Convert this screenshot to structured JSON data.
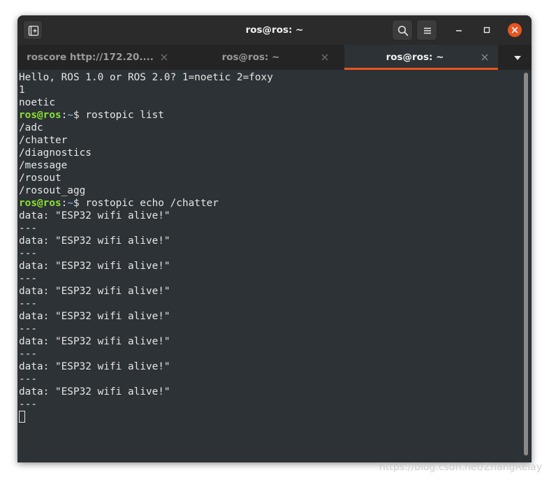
{
  "window": {
    "title": "ros@ros: ~"
  },
  "tabs": [
    {
      "label": "roscore http://172.20....",
      "active": false
    },
    {
      "label": "ros@ros: ~",
      "active": false
    },
    {
      "label": "ros@ros: ~",
      "active": true
    }
  ],
  "colors": {
    "accent": "#e95420",
    "terminal_bg": "#2d3236",
    "prompt_user": "#8ae234",
    "prompt_path": "#729fcf"
  },
  "icons": {
    "new_tab": "new-tab-icon",
    "search": "search-icon",
    "menu": "hamburger-menu-icon",
    "minimize": "minimize-icon",
    "maximize": "maximize-icon",
    "close": "close-icon",
    "tab_close": "close-icon",
    "tab_list": "chevron-down-icon"
  },
  "terminal": {
    "lines": [
      {
        "text": "Hello, ROS 1.0 or ROS 2.0? 1=noetic 2=foxy"
      },
      {
        "text": "1"
      },
      {
        "text": "noetic"
      },
      {
        "prompt_user": "ros@ros",
        "prompt_sep": ":",
        "prompt_path": "~",
        "prompt_symbol": "$ ",
        "text": "rostopic list"
      },
      {
        "text": "/adc"
      },
      {
        "text": "/chatter"
      },
      {
        "text": "/diagnostics"
      },
      {
        "text": "/message"
      },
      {
        "text": "/rosout"
      },
      {
        "text": "/rosout_agg"
      },
      {
        "prompt_user": "ros@ros",
        "prompt_sep": ":",
        "prompt_path": "~",
        "prompt_symbol": "$ ",
        "text": "rostopic echo /chatter"
      },
      {
        "text": "data: \"ESP32 wifi alive!\""
      },
      {
        "text": "---"
      },
      {
        "text": "data: \"ESP32 wifi alive!\""
      },
      {
        "text": "---"
      },
      {
        "text": "data: \"ESP32 wifi alive!\""
      },
      {
        "text": "---"
      },
      {
        "text": "data: \"ESP32 wifi alive!\""
      },
      {
        "text": "---"
      },
      {
        "text": "data: \"ESP32 wifi alive!\""
      },
      {
        "text": "---"
      },
      {
        "text": "data: \"ESP32 wifi alive!\""
      },
      {
        "text": "---"
      },
      {
        "text": "data: \"ESP32 wifi alive!\""
      },
      {
        "text": "---"
      },
      {
        "text": "data: \"ESP32 wifi alive!\""
      },
      {
        "text": "---"
      }
    ]
  },
  "watermark": "https://blog.csdn.net/ZhangRelay"
}
